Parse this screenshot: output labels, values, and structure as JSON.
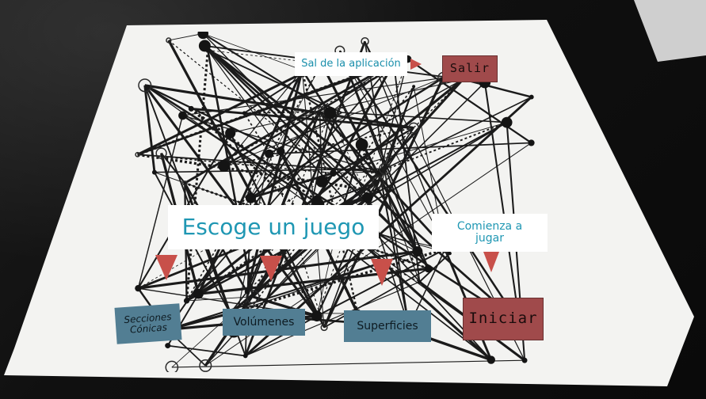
{
  "colors": {
    "label_text": "#1f97b3",
    "red_button": "#a04a4b",
    "blue_button": "#527e93",
    "arrow": "#c8504a"
  },
  "icons": {
    "pointer": "red-triangle-pointer-icon"
  },
  "header": {
    "exit_hint": "Sal de la aplicación",
    "exit_button": "Salir"
  },
  "main": {
    "title": "Escoge un juego",
    "start_hint_line1": "Comienza a",
    "start_hint_line2": "jugar",
    "start_button": "Iniciar"
  },
  "games": {
    "conic_line1": "Secciones",
    "conic_line2": "Cónicas",
    "volumes": "Volúmenes",
    "surfaces": "Superficies"
  }
}
